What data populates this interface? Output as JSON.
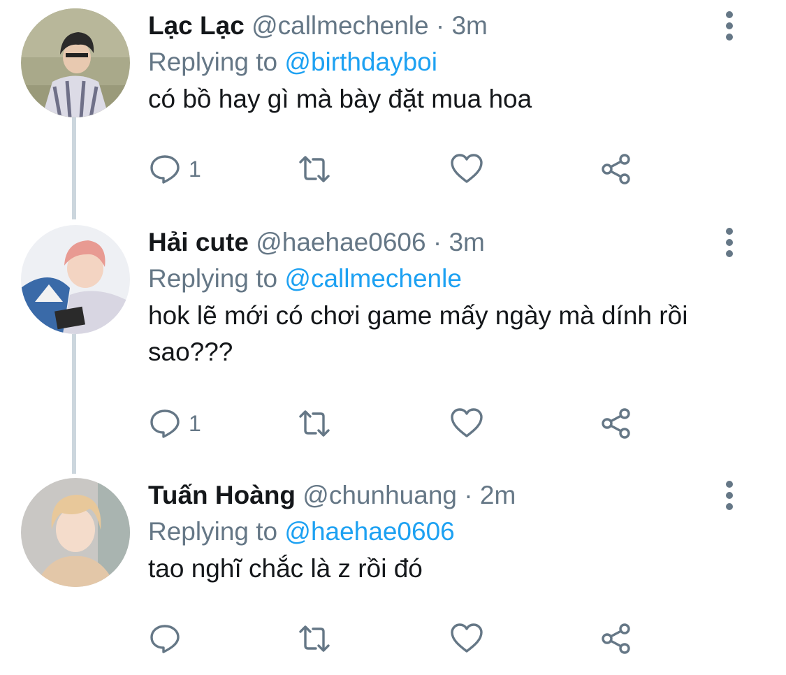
{
  "colors": {
    "name": "#14171a",
    "secondary": "#657786",
    "accent": "#1da1f2",
    "thread_line": "#ccd6dd"
  },
  "tweets": [
    {
      "name": "Lạc Lạc",
      "handle": "@callmechenle",
      "dot": "·",
      "time": "3m",
      "replying_prefix": "Replying to",
      "replying_to": "@birthdayboi",
      "text": "có bồ hay gì mà bày đặt mua hoa",
      "reply_count": "1",
      "icons": {
        "reply": "comment-icon",
        "retweet": "retweet-icon",
        "like": "heart-icon",
        "share": "share-icon",
        "more": "more-vertical-icon"
      }
    },
    {
      "name": "Hải cute",
      "handle": "@haehae0606",
      "dot": "·",
      "time": "3m",
      "replying_prefix": "Replying to",
      "replying_to": "@callmechenle",
      "text": "hok lẽ mới có chơi game mấy ngày mà dính rồi sao???",
      "reply_count": "1",
      "icons": {
        "reply": "comment-icon",
        "retweet": "retweet-icon",
        "like": "heart-icon",
        "share": "share-icon",
        "more": "more-vertical-icon"
      }
    },
    {
      "name": "Tuấn Hoàng",
      "handle": "@chunhuang",
      "dot": "·",
      "time": "2m",
      "replying_prefix": "Replying to",
      "replying_to": "@haehae0606",
      "text": "tao nghĩ chắc là z rồi đó",
      "reply_count": "",
      "icons": {
        "reply": "comment-icon",
        "retweet": "retweet-icon",
        "like": "heart-icon",
        "share": "share-icon",
        "more": "more-vertical-icon"
      }
    }
  ]
}
